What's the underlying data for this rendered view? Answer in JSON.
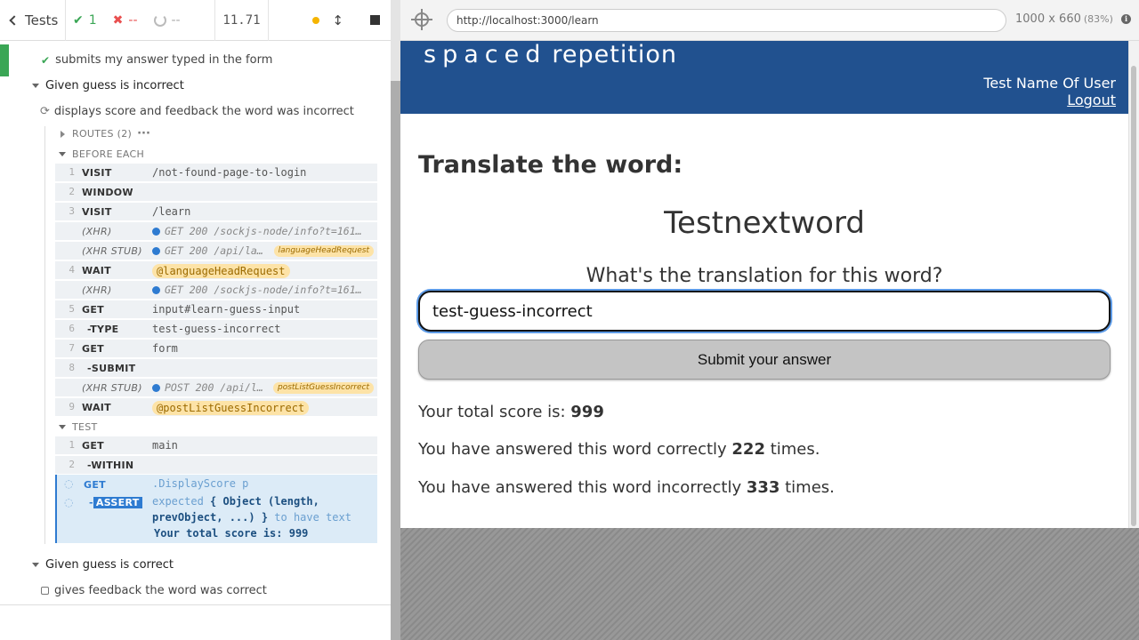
{
  "reporter": {
    "tests_label": "Tests",
    "passed": "1",
    "failed": "--",
    "pending": "--",
    "duration": "11.71",
    "tests": [
      {
        "title": "submits my answer typed in the form"
      }
    ],
    "suite_incorrect": "Given guess is incorrect",
    "running_test": "displays score and feedback the word was incorrect",
    "routes_label": "ROUTES (2)",
    "before_each_label": "BEFORE EACH",
    "before_each": [
      {
        "num": "1",
        "name": "VISIT",
        "msg": "/not-found-page-to-login"
      },
      {
        "num": "2",
        "name": "WINDOW",
        "msg": ""
      },
      {
        "num": "3",
        "name": "VISIT",
        "msg": "/learn"
      },
      {
        "num": "",
        "name": "(XHR)",
        "msg": "GET 200 /sockjs-node/info?t=161…"
      },
      {
        "num": "",
        "name": "(XHR STUB)",
        "msg": "GET 200 /api/la…",
        "alias": "languageHeadRequest"
      },
      {
        "num": "4",
        "name": "WAIT",
        "msg": "",
        "alias_pill": "@languageHeadRequest"
      },
      {
        "num": "",
        "name": "(XHR)",
        "msg": "GET 200 /sockjs-node/info?t=161…"
      },
      {
        "num": "5",
        "name": "GET",
        "msg": "input#learn-guess-input"
      },
      {
        "num": "6",
        "name": "-TYPE",
        "msg": "test-guess-incorrect"
      },
      {
        "num": "7",
        "name": "GET",
        "msg": "form"
      },
      {
        "num": "8",
        "name": "-SUBMIT",
        "msg": ""
      },
      {
        "num": "",
        "name": "(XHR STUB)",
        "msg": "POST 200 /api/l…",
        "alias": "postListGuessIncorrect"
      },
      {
        "num": "9",
        "name": "WAIT",
        "msg": "",
        "alias_pill": "@postListGuessIncorrect"
      }
    ],
    "test_label": "TEST",
    "test_cmds": [
      {
        "num": "1",
        "name": "GET",
        "msg": "main"
      },
      {
        "num": "2",
        "name": "-WITHIN",
        "msg": ""
      }
    ],
    "active": {
      "get_name": "GET",
      "get_msg": ".DisplayScore p",
      "assert_name": "ASSERT",
      "expected": "expected",
      "object_text": "{ Object (length,",
      "object_text2": "prevObject, ...) }",
      "to_have_text": "to have text",
      "text_value": "Your total score is: 999"
    },
    "suite_correct": "Given guess is correct",
    "pending_test": "gives feedback the word was correct"
  },
  "aut": {
    "url": "http://localhost:3000/learn",
    "viewport": "1000 x 660",
    "scale": "(83%)",
    "app": {
      "brand_spaced": "spaced",
      "brand_rest": "repetition",
      "user_name": "Test Name Of User",
      "logout": "Logout",
      "translate_title": "Translate the word:",
      "word": "Testnextword",
      "question": "What's the translation for this word?",
      "input_value": "test-guess-incorrect",
      "submit_label": "Submit your answer",
      "score_prefix": "Your total score is: ",
      "score": "999",
      "correct_prefix": "You have answered this word correctly ",
      "correct_count": "222",
      "correct_suffix": " times.",
      "incorrect_prefix": "You have answered this word incorrectly ",
      "incorrect_count": "333",
      "incorrect_suffix": " times."
    }
  },
  "colors": {
    "pass": "#3aa655",
    "fail": "#e94f4f",
    "header_blue": "#21518f",
    "active_blue": "#2e7bd1"
  }
}
